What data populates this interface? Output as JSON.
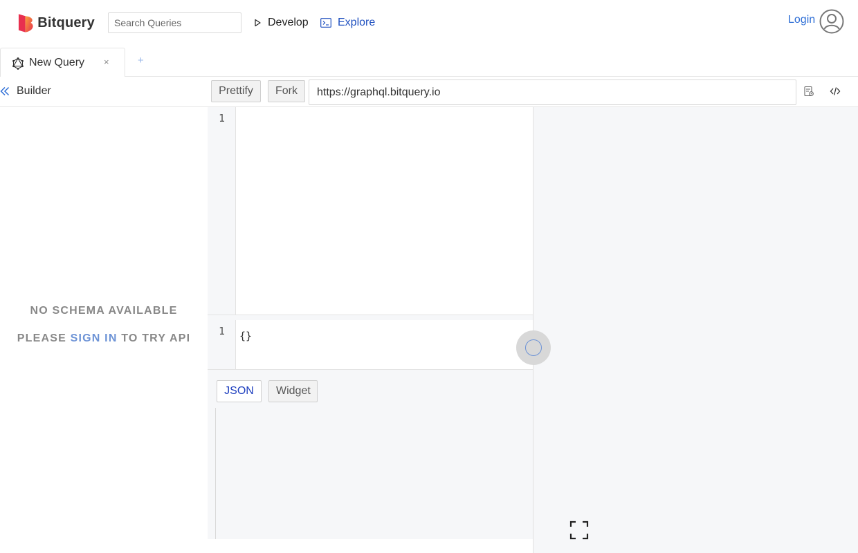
{
  "header": {
    "brand": "Bitquery",
    "search_placeholder": "Search Queries",
    "nav": {
      "develop": "Develop",
      "explore": "Explore"
    },
    "login": "Login"
  },
  "tabs": [
    {
      "label": "New Query",
      "close": "×"
    }
  ],
  "tab_add": "+",
  "toolbar": {
    "builder": "Builder",
    "prettify": "Prettify",
    "fork": "Fork",
    "endpoint": "https://graphql.bitquery.io"
  },
  "schema": {
    "no_schema": "NO SCHEMA AVAILABLE",
    "please": "PLEASE",
    "sign_in": "SIGN IN",
    "to_try": "TO TRY API"
  },
  "query_editor": {
    "line_number": "1"
  },
  "variables_editor": {
    "line_number": "1",
    "text": "{}"
  },
  "results": {
    "json": "JSON",
    "widget": "Widget"
  },
  "colors": {
    "accent": "#1e4fbf",
    "link": "#2f6fd6",
    "panel_bg": "#f6f7f9",
    "logo_red": "#e8304f",
    "logo_orange": "#f47b2a"
  }
}
